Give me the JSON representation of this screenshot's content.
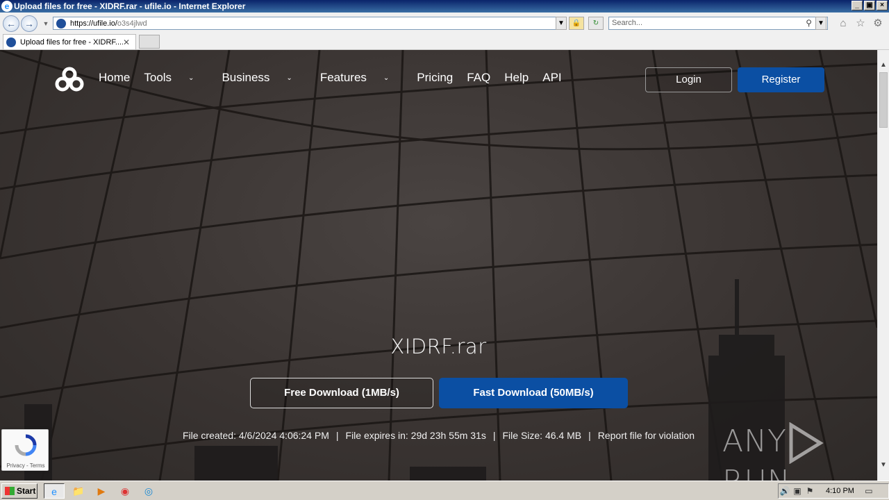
{
  "window": {
    "title": "Upload files for free - XIDRF.rar - ufile.io - Internet Explorer",
    "controls": [
      "_",
      "▣",
      "×"
    ]
  },
  "addressbar": {
    "url_host": "https://ufile.io/",
    "url_path": "o3s4jlwd",
    "search_placeholder": "Search..."
  },
  "tabs": [
    {
      "label": "Upload files for free - XIDRF...."
    }
  ],
  "site": {
    "nav": {
      "home": "Home",
      "tools": "Tools",
      "business": "Business",
      "features": "Features",
      "pricing": "Pricing",
      "faq": "FAQ",
      "help": "Help",
      "api": "API"
    },
    "login": "Login",
    "register": "Register"
  },
  "file": {
    "name": "XIDRF.rar",
    "free_download": "Free Download (1MB/s)",
    "fast_download": "Fast Download (50MB/s)",
    "created": "File created: 4/6/2024 4:06:24 PM",
    "expires": "File expires in: 29d 23h 55m 31s",
    "size": "File Size: 46.4 MB",
    "report": "Report file for violation",
    "separator": "|"
  },
  "recaptcha": {
    "links": "Privacy - Terms"
  },
  "watermark": {
    "left": "ANY",
    "right": "RUN"
  },
  "taskbar": {
    "start": "Start",
    "clock": "4:10 PM"
  },
  "colors": {
    "brand_blue": "#0b4fa3",
    "page_bg": "#3a3432"
  }
}
